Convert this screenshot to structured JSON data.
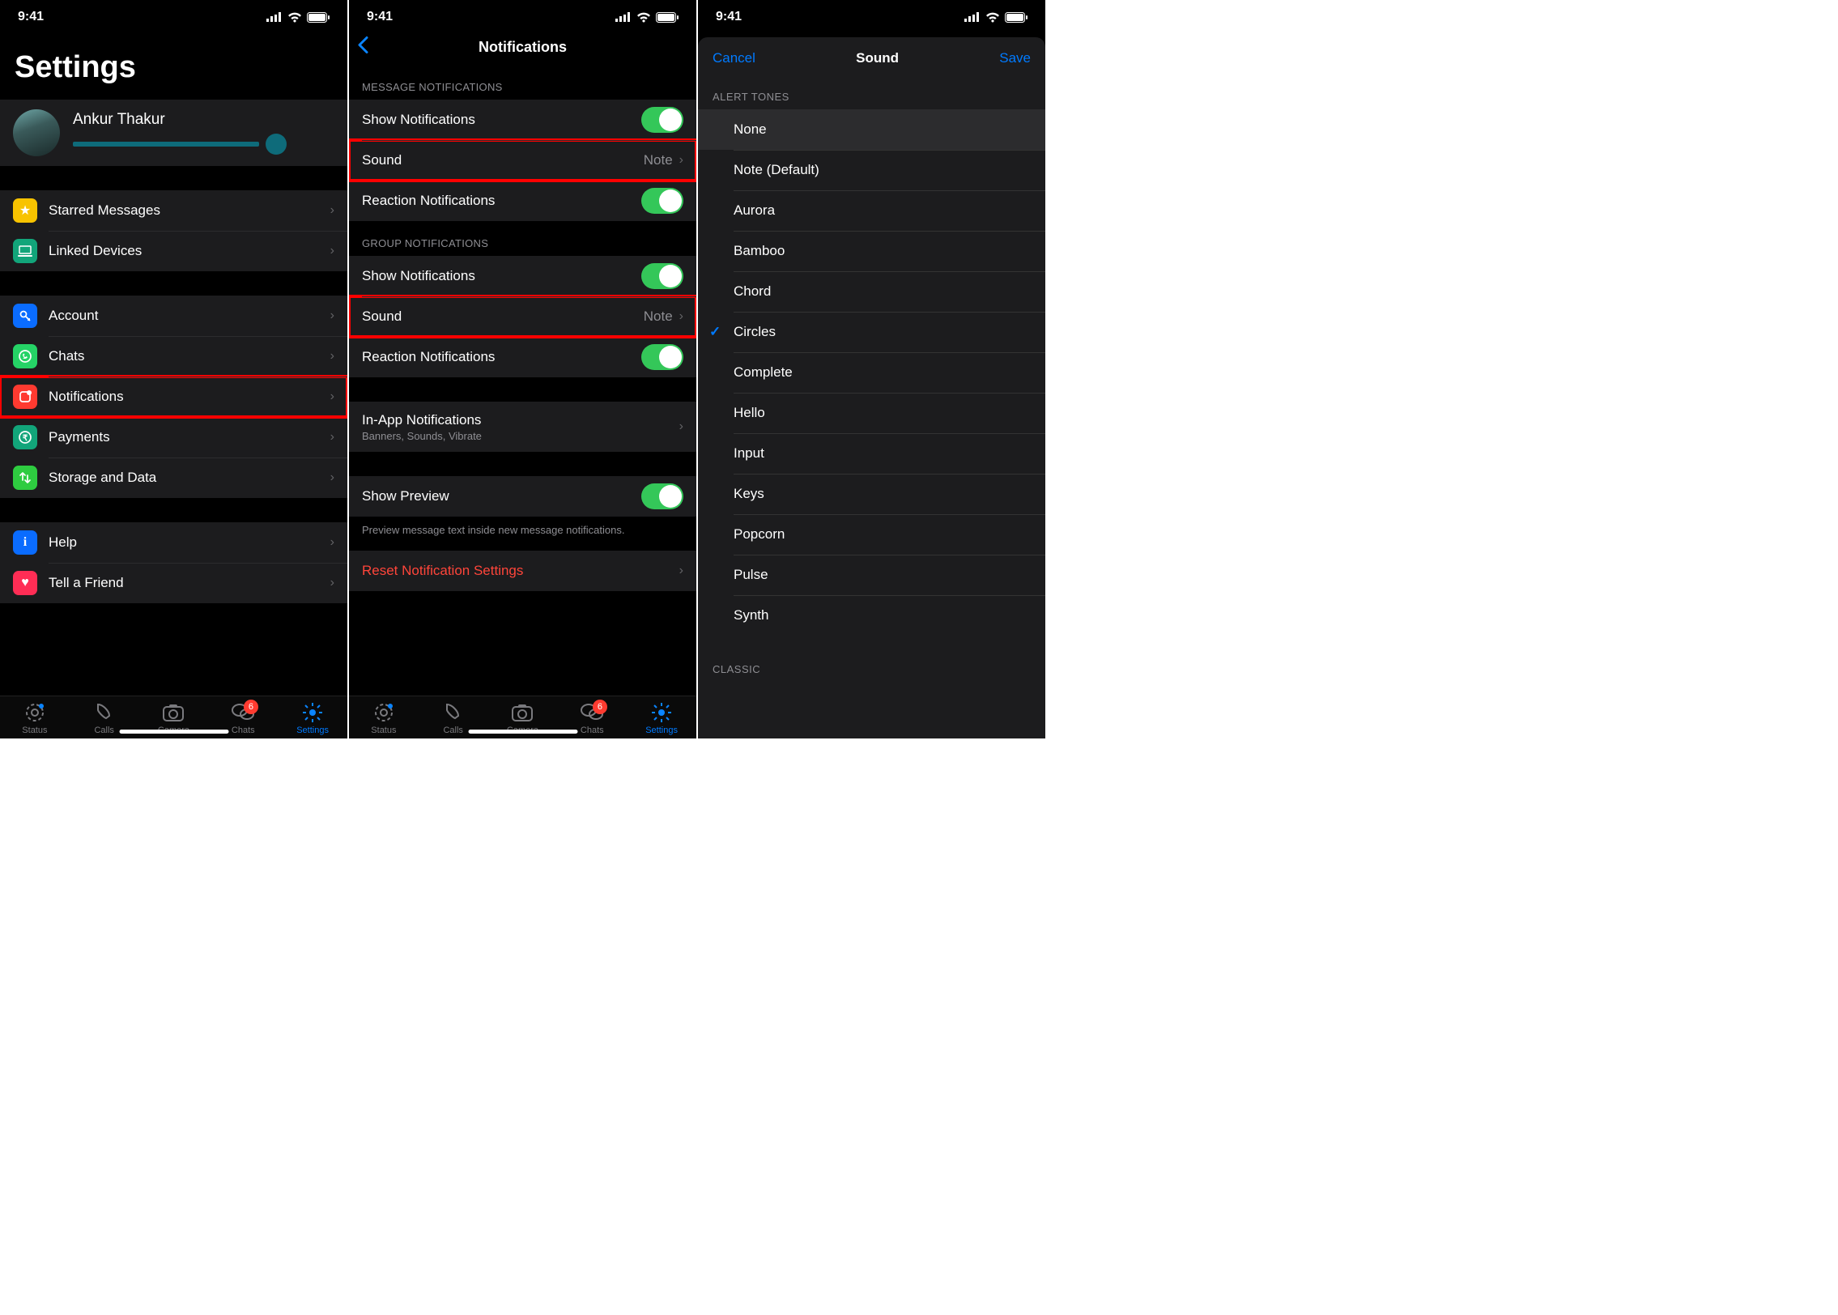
{
  "status_time": "9:41",
  "p1": {
    "title": "Settings",
    "profile_name": "Ankur Thakur",
    "starred": "Starred Messages",
    "linked": "Linked Devices",
    "account": "Account",
    "chats": "Chats",
    "notifications": "Notifications",
    "payments": "Payments",
    "storage": "Storage and Data",
    "help": "Help",
    "tell": "Tell a Friend",
    "tab_status": "Status",
    "tab_calls": "Calls",
    "tab_camera": "Camera",
    "tab_chats": "Chats",
    "tab_settings": "Settings",
    "badge": "6"
  },
  "p2": {
    "title": "Notifications",
    "sec_msg": "MESSAGE NOTIFICATIONS",
    "show": "Show Notifications",
    "sound": "Sound",
    "sound_val": "Note",
    "react": "Reaction Notifications",
    "sec_grp": "GROUP NOTIFICATIONS",
    "inapp": "In-App Notifications",
    "inapp_sub": "Banners, Sounds, Vibrate",
    "preview": "Show Preview",
    "preview_foot": "Preview message text inside new message notifications.",
    "reset": "Reset Notification Settings"
  },
  "p3": {
    "cancel": "Cancel",
    "title": "Sound",
    "save": "Save",
    "sec_alert": "ALERT TONES",
    "tones": [
      "None",
      "Note (Default)",
      "Aurora",
      "Bamboo",
      "Chord",
      "Circles",
      "Complete",
      "Hello",
      "Input",
      "Keys",
      "Popcorn",
      "Pulse",
      "Synth"
    ],
    "selected": "Circles",
    "sec_classic": "CLASSIC"
  }
}
